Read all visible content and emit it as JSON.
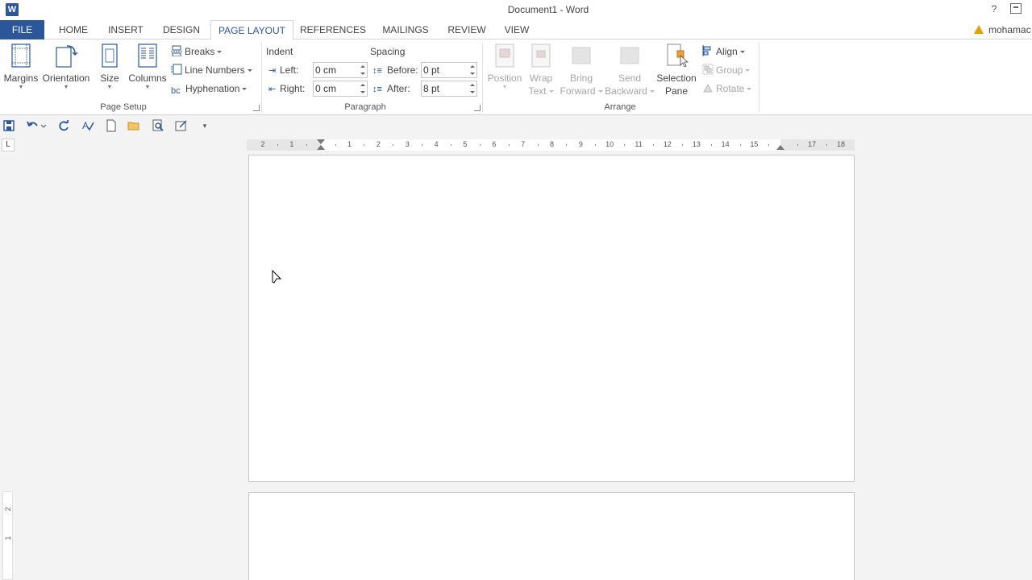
{
  "window": {
    "title": "Document1 - Word",
    "app_icon": "W",
    "help": "?"
  },
  "tabs": [
    {
      "label": "FILE"
    },
    {
      "label": "HOME"
    },
    {
      "label": "INSERT"
    },
    {
      "label": "DESIGN"
    },
    {
      "label": "PAGE LAYOUT"
    },
    {
      "label": "REFERENCES"
    },
    {
      "label": "MAILINGS"
    },
    {
      "label": "REVIEW"
    },
    {
      "label": "VIEW"
    }
  ],
  "user": {
    "name": "mohamac"
  },
  "page_setup": {
    "label": "Page Setup",
    "margins": "Margins",
    "orientation": "Orientation",
    "size": "Size",
    "columns": "Columns",
    "breaks": "Breaks",
    "line_numbers": "Line Numbers",
    "hyphenation": "Hyphenation"
  },
  "paragraph": {
    "label": "Paragraph",
    "indent": "Indent",
    "spacing": "Spacing",
    "left_label": "Left:",
    "left_value": "0 cm",
    "right_label": "Right:",
    "right_value": "0 cm",
    "before_label": "Before:",
    "before_value": "0 pt",
    "after_label": "After:",
    "after_value": "8 pt"
  },
  "arrange": {
    "label": "Arrange",
    "position": "Position",
    "wrap_text_1": "Wrap",
    "wrap_text_2": "Text",
    "bring_forward_1": "Bring",
    "bring_forward_2": "Forward",
    "send_backward_1": "Send",
    "send_backward_2": "Backward",
    "selection_pane_1": "Selection",
    "selection_pane_2": "Pane",
    "align": "Align",
    "group": "Group",
    "rotate": "Rotate"
  },
  "ruler": {
    "tab_selector": "L",
    "numbers": [
      "2",
      "1",
      "",
      "1",
      "2",
      "3",
      "4",
      "5",
      "6",
      "7",
      "8",
      "9",
      "10",
      "11",
      "12",
      "13",
      "14",
      "15",
      "",
      "17",
      "18"
    ],
    "vertical_numbers": [
      "2",
      "1"
    ]
  },
  "colors": {
    "accent": "#2b579a",
    "warning": "#e5a000"
  }
}
